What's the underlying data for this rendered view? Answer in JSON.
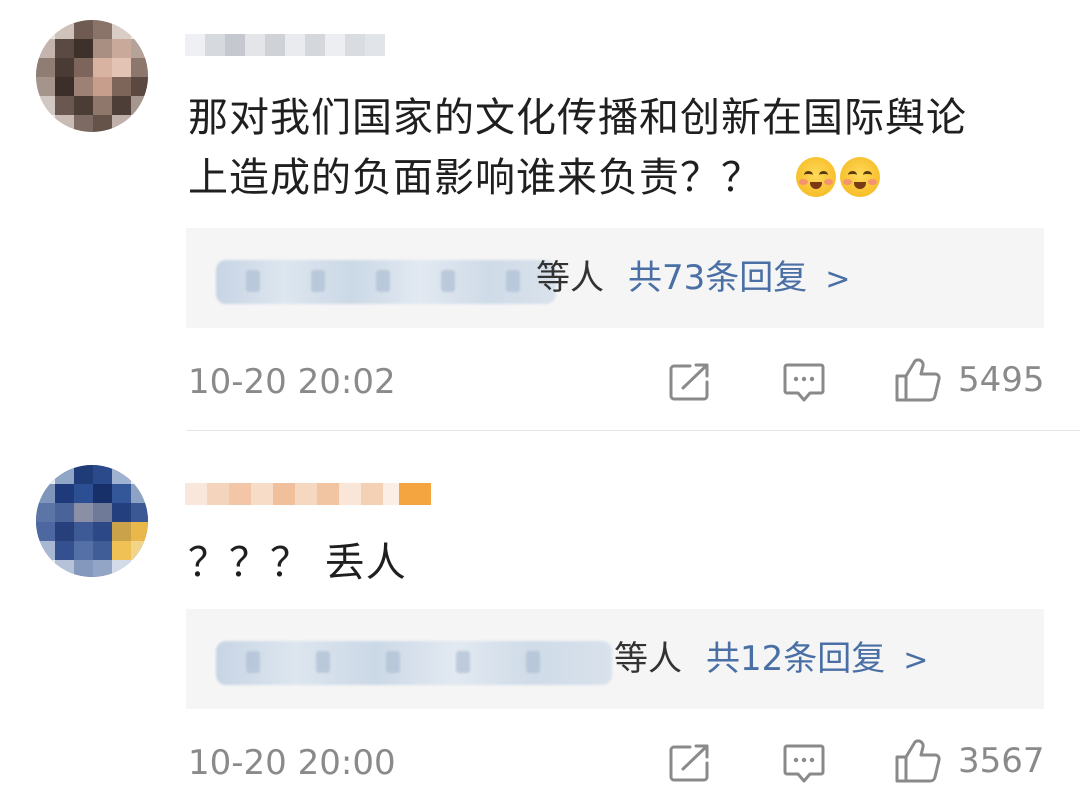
{
  "comments": [
    {
      "text_line1": "那对我们国家的文化传播和创新在国际舆论",
      "text_line2": "上造成的负面影响谁来负责？？",
      "reply_suffix": "等人",
      "reply_count_label": "共73条回复",
      "timestamp": "10-20 20:02",
      "likes": "5495"
    },
    {
      "text_line1": "？？？ 丢人",
      "reply_suffix": "等人",
      "reply_count_label": "共12条回复",
      "timestamp": "10-20 20:00",
      "likes": "3567"
    }
  ],
  "icons": {
    "share": "share-icon",
    "reply": "comment-icon",
    "like": "thumbs-up-icon",
    "reply_arrow": "chevron-right-icon",
    "emoji": "blushing-smile-emoji-icon"
  },
  "colors": {
    "link": "#4a6fa5",
    "meta": "#8a8a8a",
    "text": "#1f1f1f",
    "reply_bg": "#f5f5f5"
  }
}
